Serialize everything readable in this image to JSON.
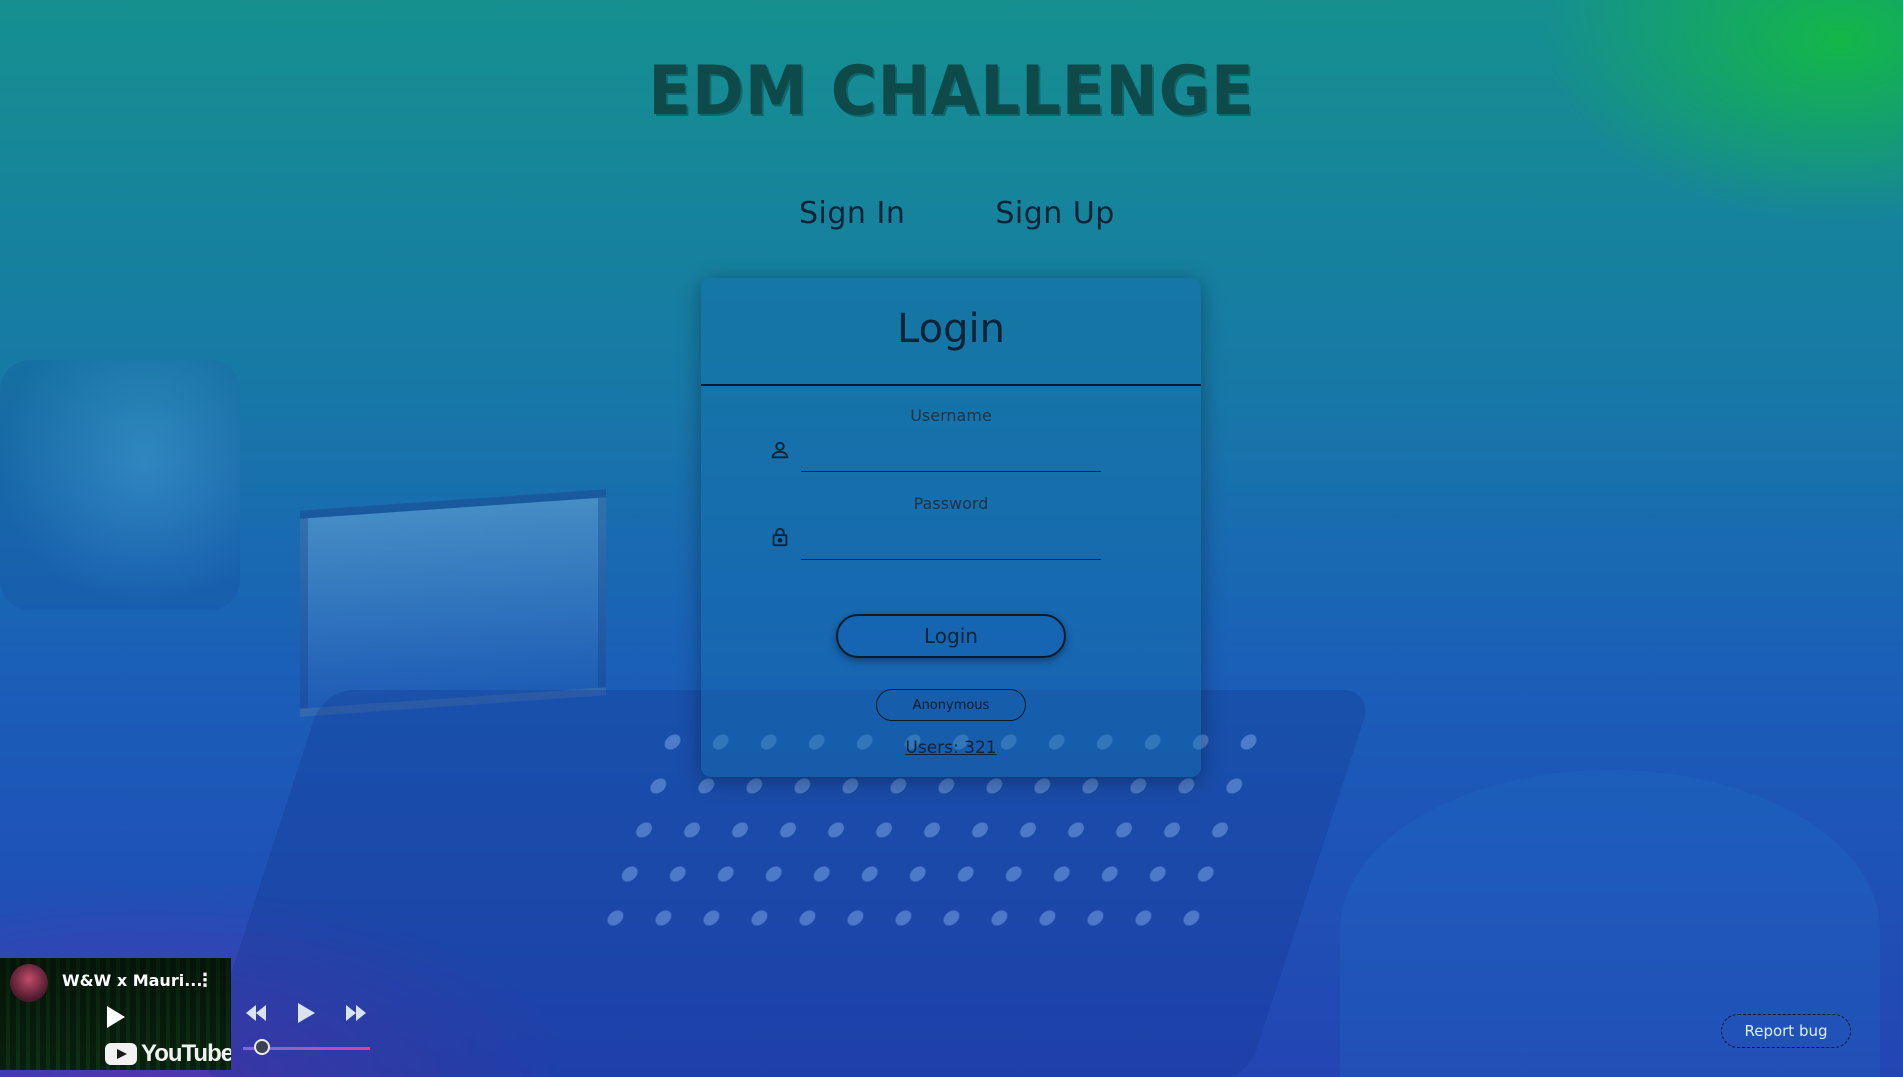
{
  "app": {
    "title": "EDM CHALLENGE"
  },
  "auth_tabs": {
    "sign_in": "Sign In",
    "sign_up": "Sign Up"
  },
  "login_card": {
    "title": "Login",
    "username_label": "Username",
    "username_value": "",
    "password_label": "Password",
    "password_value": "",
    "login_button": "Login",
    "anonymous_button": "Anonymous",
    "users_count": "Users: 321"
  },
  "player": {
    "video_title": "W&W x Mauri...",
    "icons": {
      "rewind": "rewind-icon",
      "play": "play-icon",
      "forward": "fast-forward-icon",
      "menu": "more-vert-icon"
    },
    "thumbnail_brand": "YouTube",
    "progress": 0.15
  },
  "footer": {
    "report_bug": "Report bug"
  },
  "colors": {
    "text_dark": "#0d2336",
    "accent_gradient_start": "#7b6be8",
    "accent_gradient_end": "#e0408a",
    "title_color": "#0f4a4a"
  }
}
